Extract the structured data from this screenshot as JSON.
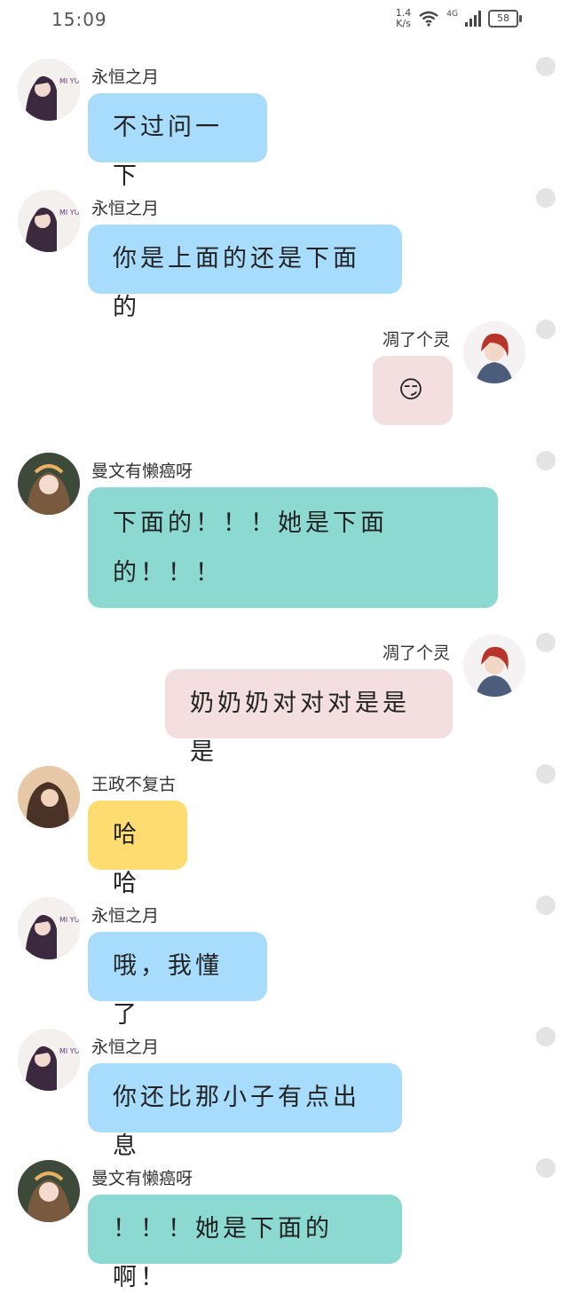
{
  "status_bar": {
    "time": "15:09",
    "net_speed_value": "1.4",
    "net_speed_unit": "K/s",
    "network": "4G",
    "battery": "58"
  },
  "messages": [
    {
      "sender": "永恒之月",
      "text": "不过问一下",
      "side": "left",
      "bubble_color": "#a8dcfc"
    },
    {
      "sender": "永恒之月",
      "text": "你是上面的还是下面的",
      "side": "left",
      "bubble_color": "#a8dcfc"
    },
    {
      "sender": "凋了个灵",
      "text": "😏",
      "side": "right",
      "bubble_color": "#f3dfe0"
    },
    {
      "sender": "曼文有懒癌呀",
      "text": "下面的！！！她是下面的！！！",
      "side": "left",
      "bubble_color": "#8cd9d1"
    },
    {
      "sender": "凋了个灵",
      "text": "奶奶奶对对对是是是",
      "side": "right",
      "bubble_color": "#f3dfe0"
    },
    {
      "sender": "王政不复古",
      "text": "哈哈",
      "side": "left",
      "bubble_color": "#fedc70"
    },
    {
      "sender": "永恒之月",
      "text": "哦，我懂了",
      "side": "left",
      "bubble_color": "#a8dcfc"
    },
    {
      "sender": "永恒之月",
      "text": "你还比那小子有点出息",
      "side": "left",
      "bubble_color": "#a8dcfc"
    },
    {
      "sender": "曼文有懒癌呀",
      "text": "！！！她是下面的啊！",
      "side": "left",
      "bubble_color": "#8cd9d1"
    }
  ],
  "avatar_logo_text": "MI YUE"
}
